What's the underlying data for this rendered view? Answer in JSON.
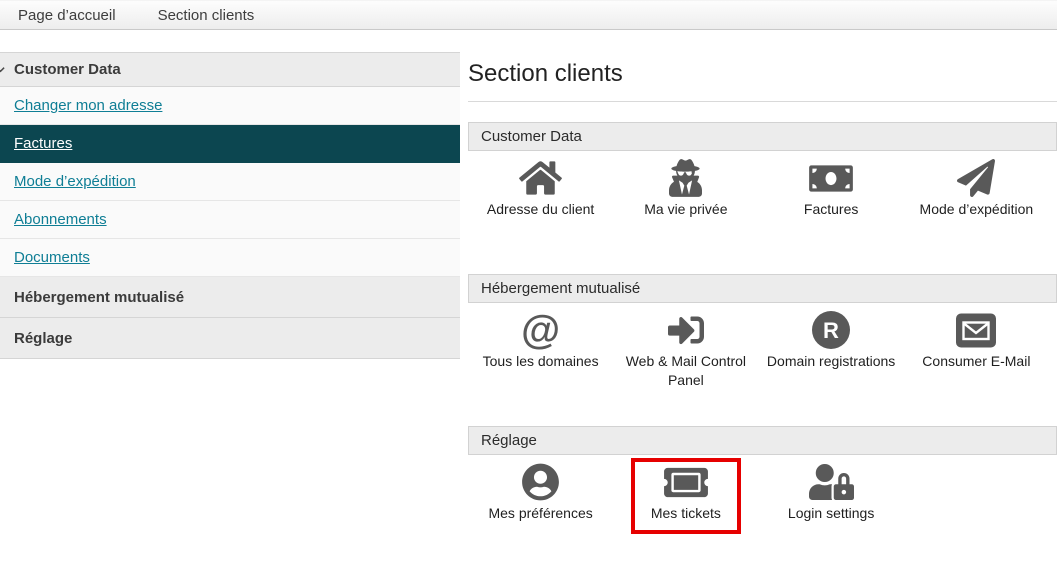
{
  "topbar": {
    "items": [
      {
        "label": "Page d’accueil"
      },
      {
        "label": "Section clients"
      }
    ]
  },
  "sidebar": {
    "sections": [
      {
        "label": "Customer Data",
        "expanded": true,
        "links": [
          {
            "label": "Changer mon adresse",
            "selected": false
          },
          {
            "label": "Factures",
            "selected": true
          },
          {
            "label": "Mode d’expédition",
            "selected": false
          },
          {
            "label": "Abonnements",
            "selected": false
          },
          {
            "label": "Documents",
            "selected": false
          }
        ]
      },
      {
        "label": "Hébergement mutualisé",
        "expanded": false,
        "links": []
      },
      {
        "label": "Réglage",
        "expanded": false,
        "links": []
      }
    ]
  },
  "main": {
    "title": "Section clients",
    "sections": [
      {
        "label": "Customer Data",
        "items": [
          {
            "label": "Adresse du client",
            "icon": "home-icon"
          },
          {
            "label": "Ma vie privée",
            "icon": "spy-icon"
          },
          {
            "label": "Factures",
            "icon": "banknote-icon"
          },
          {
            "label": "Mode d’expédition",
            "icon": "paper-plane-icon"
          }
        ]
      },
      {
        "label": "Hébergement mutualisé",
        "items": [
          {
            "label": "Tous les domaines",
            "icon": "at-sign-icon"
          },
          {
            "label": "Web & Mail Control Panel",
            "icon": "sign-in-icon"
          },
          {
            "label": "Domain registrations",
            "icon": "registered-icon"
          },
          {
            "label": "Consumer E-Mail",
            "icon": "envelope-icon"
          }
        ]
      },
      {
        "label": "Réglage",
        "items": [
          {
            "label": "Mes préférences",
            "icon": "user-circle-icon"
          },
          {
            "label": "Mes tickets",
            "icon": "ticket-icon",
            "highlighted": true
          },
          {
            "label": "Login settings",
            "icon": "user-lock-icon"
          }
        ]
      }
    ]
  },
  "annotation": {
    "highlight_target": "Mes tickets",
    "highlight_color": "#e60000"
  },
  "colors": {
    "link_teal": "#0f7e95",
    "selected_row_bg": "#0c4650",
    "icon_gray": "#595959",
    "section_bar_bg": "#ececec",
    "highlight_red": "#e60000"
  }
}
